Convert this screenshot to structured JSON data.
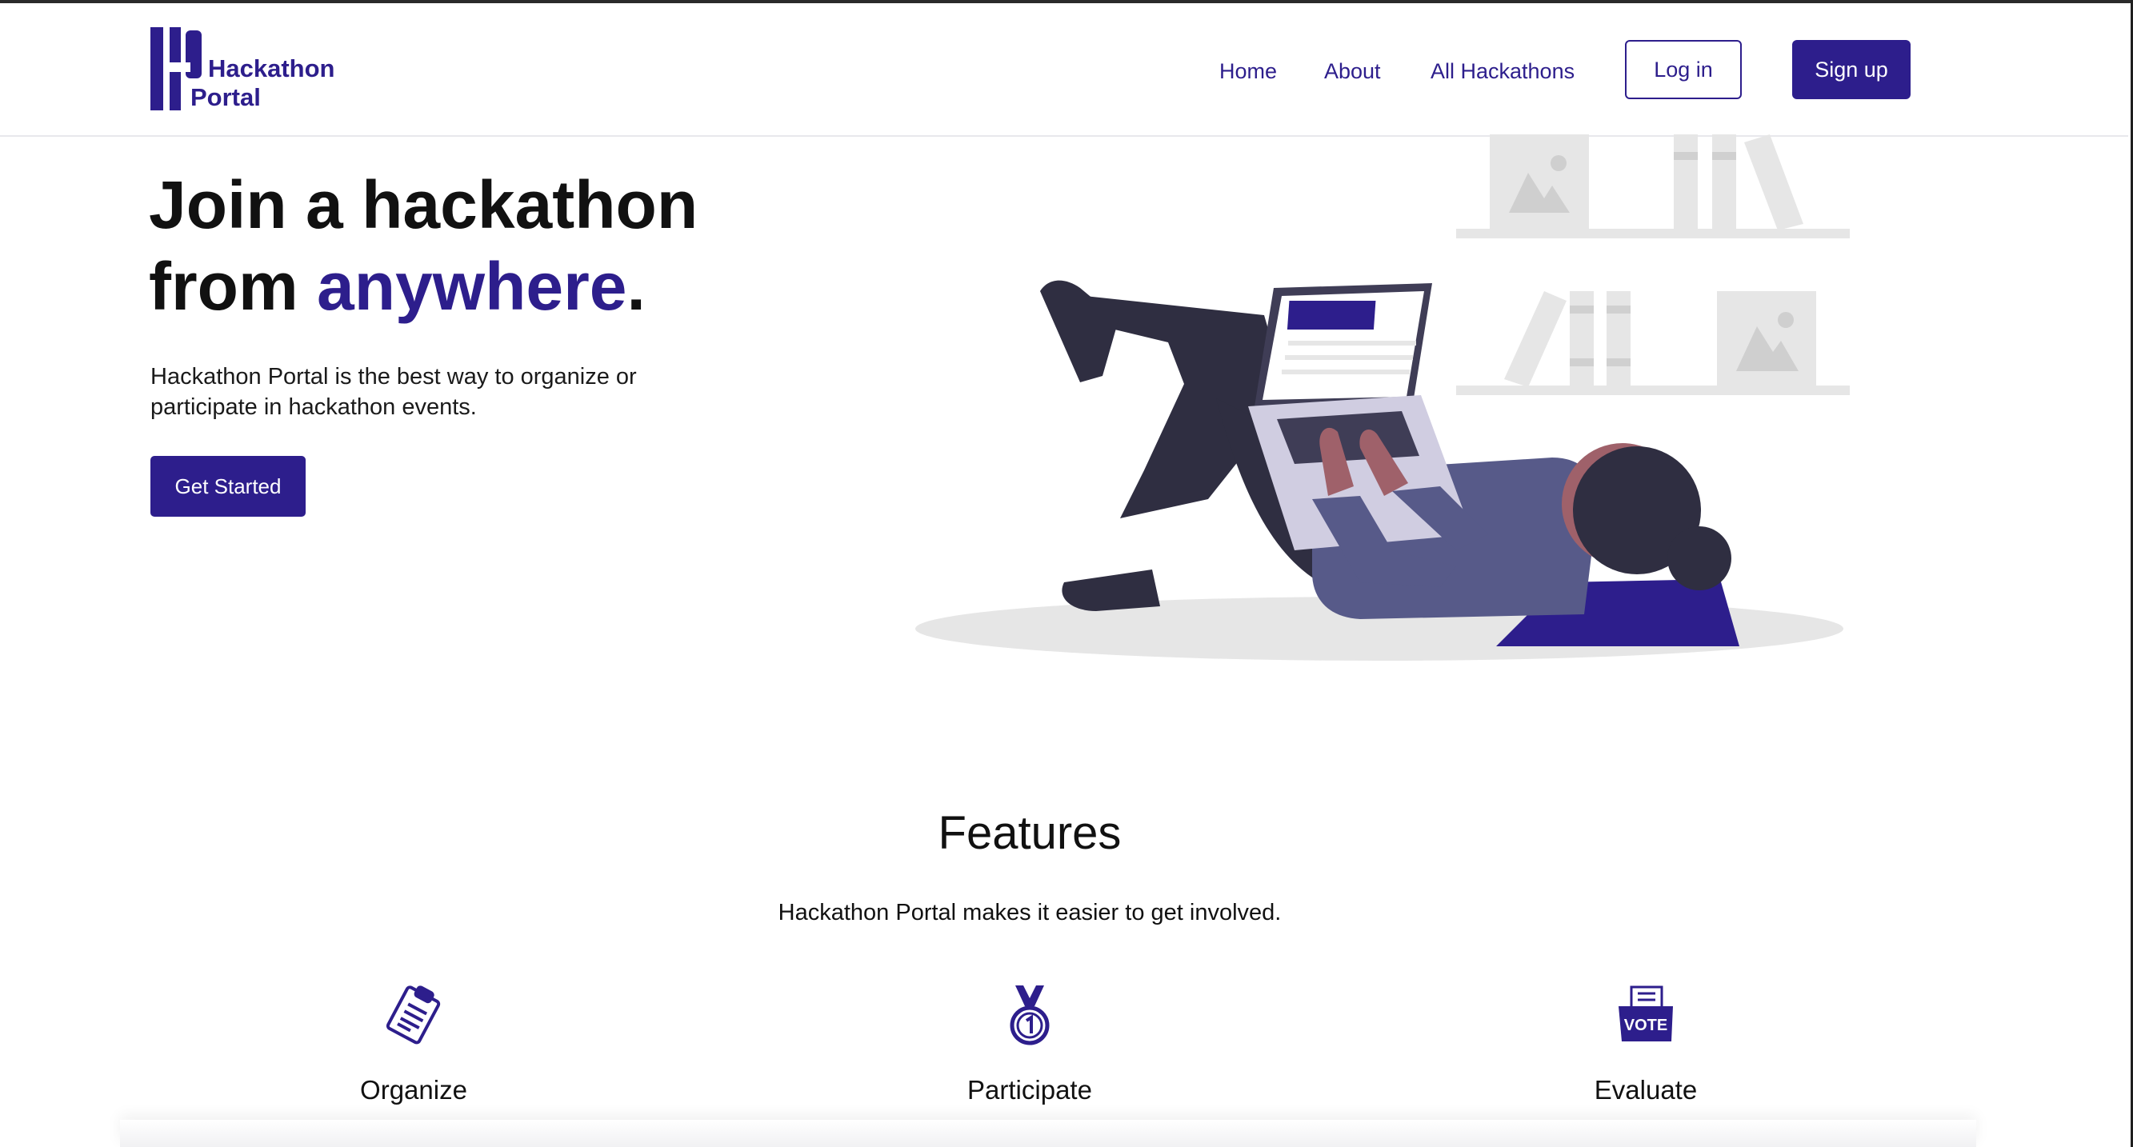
{
  "header": {
    "logo": {
      "line1": "Hackathon",
      "line2": "Portal"
    },
    "nav": [
      {
        "label": "Home"
      },
      {
        "label": "About"
      },
      {
        "label": "All Hackathons"
      }
    ],
    "login_label": "Log in",
    "signup_label": "Sign up"
  },
  "hero": {
    "title_line1": "Join a hackathon",
    "title_from": "from ",
    "title_accent": "anywhere",
    "title_end": ".",
    "subtitle": "Hackathon Portal is the best way to organize or participate in hackathon events.",
    "cta_label": "Get Started"
  },
  "features": {
    "title": "Features",
    "subtitle": "Hackathon Portal makes it easier to get involved.",
    "items": [
      {
        "name": "Organize",
        "icon": "clipboard-icon"
      },
      {
        "name": "Participate",
        "icon": "medal-icon"
      },
      {
        "name": "Evaluate",
        "icon": "vote-box-icon"
      }
    ]
  },
  "colors": {
    "brand": "#2d1e8c"
  }
}
